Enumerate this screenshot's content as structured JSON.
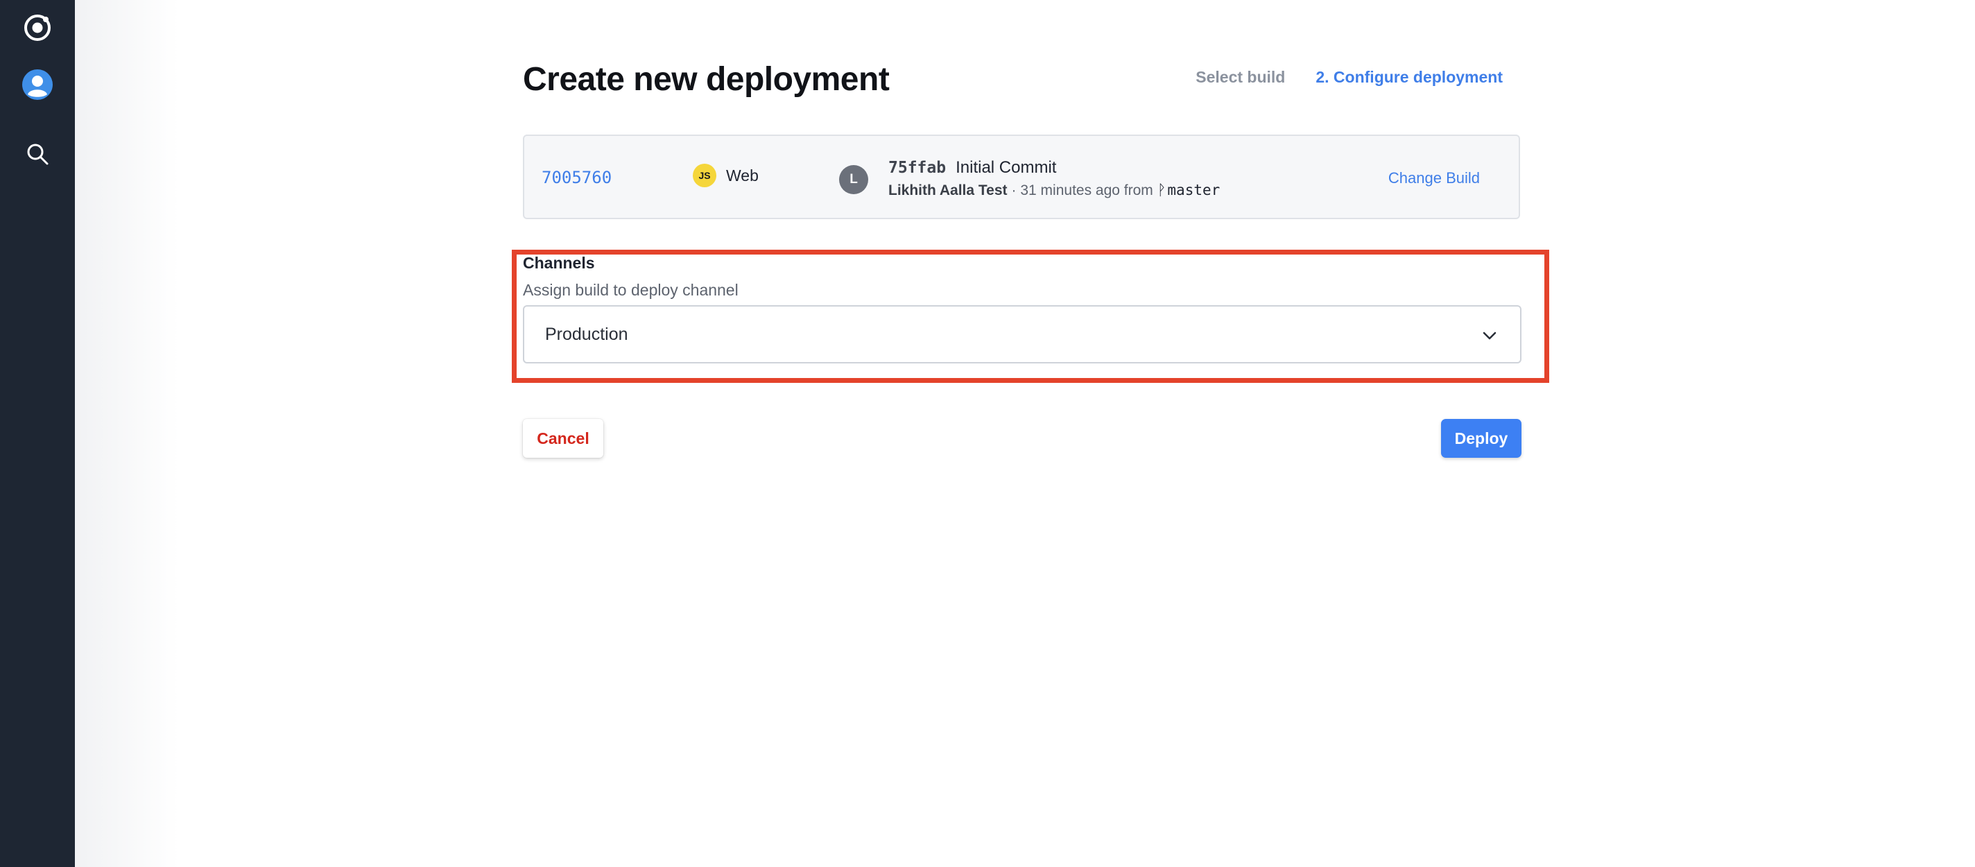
{
  "nav": {
    "items": [
      {
        "icon": "ionic-logo-icon"
      },
      {
        "icon": "user-avatar-icon"
      },
      {
        "icon": "search-icon"
      }
    ]
  },
  "page": {
    "title": "Create new deployment",
    "steps": {
      "step1": "Select build",
      "step2": "2. Configure deployment"
    }
  },
  "build": {
    "id": "7005760",
    "platform_badge": "JS",
    "platform": "Web",
    "author_initial": "L",
    "commit_sha": "75ffab",
    "commit_message": "Initial Commit",
    "author": "Likhith Aalla Test",
    "time_text": "· 31 minutes ago from",
    "branch_icon": "ᚹ",
    "branch": "master",
    "change_label": "Change Build"
  },
  "channels": {
    "title": "Channels",
    "description": "Assign build to deploy channel",
    "selected": "Production"
  },
  "actions": {
    "cancel": "Cancel",
    "deploy": "Deploy"
  },
  "colors": {
    "accent": "#3f7ee8",
    "highlight": "#e4432b",
    "danger": "#d4271d",
    "rail": "#1e2633"
  }
}
